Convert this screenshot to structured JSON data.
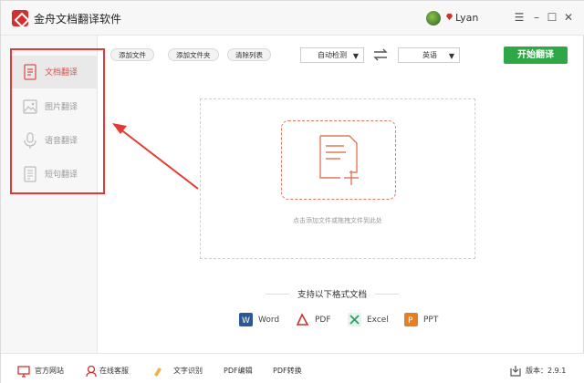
{
  "app": {
    "title": "金舟文档翻译软件",
    "user_name": "Lyan",
    "window_controls": [
      "menu-icon",
      "minimize-icon",
      "maximize-icon",
      "close-icon"
    ]
  },
  "sidebar": {
    "items": [
      {
        "label": "文档翻译",
        "icon": "document-icon",
        "active": true
      },
      {
        "label": "图片翻译",
        "icon": "image-icon",
        "active": false
      },
      {
        "label": "语音翻译",
        "icon": "microphone-icon",
        "active": false
      },
      {
        "label": "短句翻译",
        "icon": "text-icon",
        "active": false
      }
    ]
  },
  "toolbar": {
    "add_file": "添加文件",
    "add_folder": "添加文件夹",
    "clear_list": "清除列表",
    "source_lang": "自动检测",
    "target_lang": "英语",
    "start_button": "开始翻译"
  },
  "drop_area": {
    "hint": "点击添加文件或拖拽文件到此处"
  },
  "formats": {
    "title": "支持以下格式文档",
    "items": [
      {
        "label": "Word",
        "color": "#2b5797"
      },
      {
        "label": "PDF",
        "color": "#d32f2f"
      },
      {
        "label": "Excel",
        "color": "#21a366"
      },
      {
        "label": "PPT",
        "color": "#e67e22"
      }
    ]
  },
  "footer": {
    "official_site": "官方网站",
    "online_support": "在线客服",
    "ocr": "文字识别",
    "pdf_edit": "PDF编辑",
    "pdf_convert": "PDF转换",
    "version": "版本：2.9.1"
  },
  "colors": {
    "accent_red": "#d9534f",
    "primary_green": "#2ea845",
    "annotation_red": "#e53935"
  }
}
